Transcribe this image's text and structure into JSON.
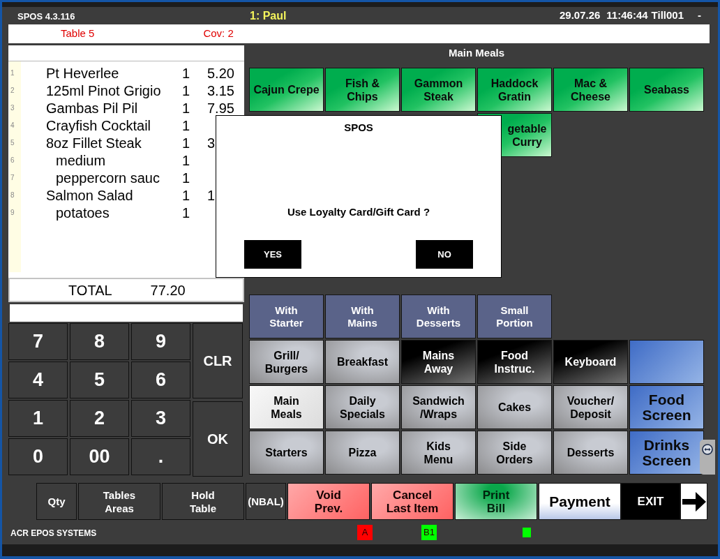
{
  "header": {
    "version": "SPOS 4.3.116",
    "user": "1: Paul",
    "date": "29.07.26",
    "time": "11:46:44",
    "till": "Till001",
    "flag": "-"
  },
  "info_bar": {
    "table": "Table 5",
    "covers": "Cov: 2"
  },
  "order": {
    "items": [
      {
        "line": "1",
        "name": "Pt Heverlee",
        "qty": "1",
        "price": "5.20"
      },
      {
        "line": "2",
        "name": "125ml Pinot Grigio",
        "qty": "1",
        "price": "3.15"
      },
      {
        "line": "3",
        "name": "Gambas Pil Pil",
        "qty": "1",
        "price": "7.95"
      },
      {
        "line": "4",
        "name": "Crayfish Cocktail",
        "qty": "1"
      },
      {
        "line": "5",
        "name": "8oz Fillet Steak",
        "qty": "1",
        "price": "3",
        "children": [
          {
            "line": "6",
            "name": "medium",
            "qty": "1"
          },
          {
            "line": "7",
            "name": "peppercorn sauc",
            "qty": "1"
          }
        ]
      },
      {
        "line": "8",
        "name": "Salmon Salad",
        "qty": "1",
        "price": "1",
        "children": [
          {
            "line": "9",
            "name": "potatoes",
            "qty": "1"
          }
        ]
      }
    ],
    "total_label": "TOTAL",
    "total": "77.20"
  },
  "keypad": {
    "digits": [
      "7",
      "8",
      "9",
      "4",
      "5",
      "6",
      "1",
      "2",
      "3",
      "0",
      "00",
      "."
    ],
    "clear": "CLR",
    "enter": "OK"
  },
  "menu": {
    "title": "Main Meals",
    "products": [
      "Cajun Crepe",
      "Fish &\nChips",
      "Gammon\nSteak",
      "Haddock\nGratin",
      "Mac &\nCheese",
      "Seabass",
      "getable\nCurry"
    ]
  },
  "modifiers": [
    "With\nStarter",
    "With\nMains",
    "With\nDesserts",
    "Small\nPortion"
  ],
  "categories": [
    {
      "kind": "category",
      "label": "Grill/\nBurgers",
      "selected": false
    },
    {
      "kind": "category",
      "label": "Breakfast",
      "selected": false
    },
    {
      "kind": "function",
      "label": "Mains\nAway",
      "selected": false
    },
    {
      "kind": "function",
      "label": "Food\nInstruc.",
      "selected": false
    },
    {
      "kind": "function",
      "label": "Keyboard",
      "selected": false
    },
    {
      "kind": "screen",
      "selected": false
    },
    {
      "kind": "category",
      "label": "Main\nMeals",
      "selected": true
    },
    {
      "kind": "category",
      "label": "Daily\nSpecials",
      "selected": false
    },
    {
      "kind": "category",
      "label": "Sandwich\n/Wraps",
      "selected": false
    },
    {
      "kind": "category",
      "label": "Cakes",
      "selected": false
    },
    {
      "kind": "category",
      "label": "Voucher/\nDeposit",
      "selected": false
    },
    {
      "kind": "screen",
      "label": "Food\nScreen",
      "selected": false
    },
    {
      "kind": "category",
      "label": "Starters",
      "selected": false
    },
    {
      "kind": "category",
      "label": "Pizza",
      "selected": false
    },
    {
      "kind": "category",
      "label": "Kids\nMenu",
      "selected": false
    },
    {
      "kind": "category",
      "label": "Side\nOrders",
      "selected": false
    },
    {
      "kind": "category",
      "label": "Desserts",
      "selected": false
    },
    {
      "kind": "screen",
      "label": "Drinks\nScreen",
      "selected": false
    }
  ],
  "actions": [
    {
      "kind": "dark",
      "label": "Qty"
    },
    {
      "kind": "dark",
      "label": "Tables\nAreas"
    },
    {
      "kind": "dark",
      "label": "Hold\nTable"
    },
    {
      "kind": "dark",
      "label": "(NBAL)"
    },
    {
      "kind": "red",
      "label": "Void\nPrev."
    },
    {
      "kind": "red",
      "label": "Cancel\nLast Item"
    },
    {
      "kind": "green",
      "label": "Print\nBill"
    },
    {
      "kind": "payment",
      "label": "Payment"
    },
    {
      "kind": "exit",
      "label": "EXIT"
    },
    {
      "kind": "arrow"
    }
  ],
  "status": {
    "brand": "ACR EPOS SYSTEMS",
    "indicators": [
      {
        "label": "A",
        "color": "#ff0000"
      },
      {
        "label": "B1",
        "color": "#00ff00"
      },
      {
        "color": "#00ff00"
      }
    ]
  },
  "dialog": {
    "title": "SPOS",
    "message": "Use Loyalty Card/Gift Card ?",
    "buttons": [
      "YES",
      "NO"
    ]
  }
}
